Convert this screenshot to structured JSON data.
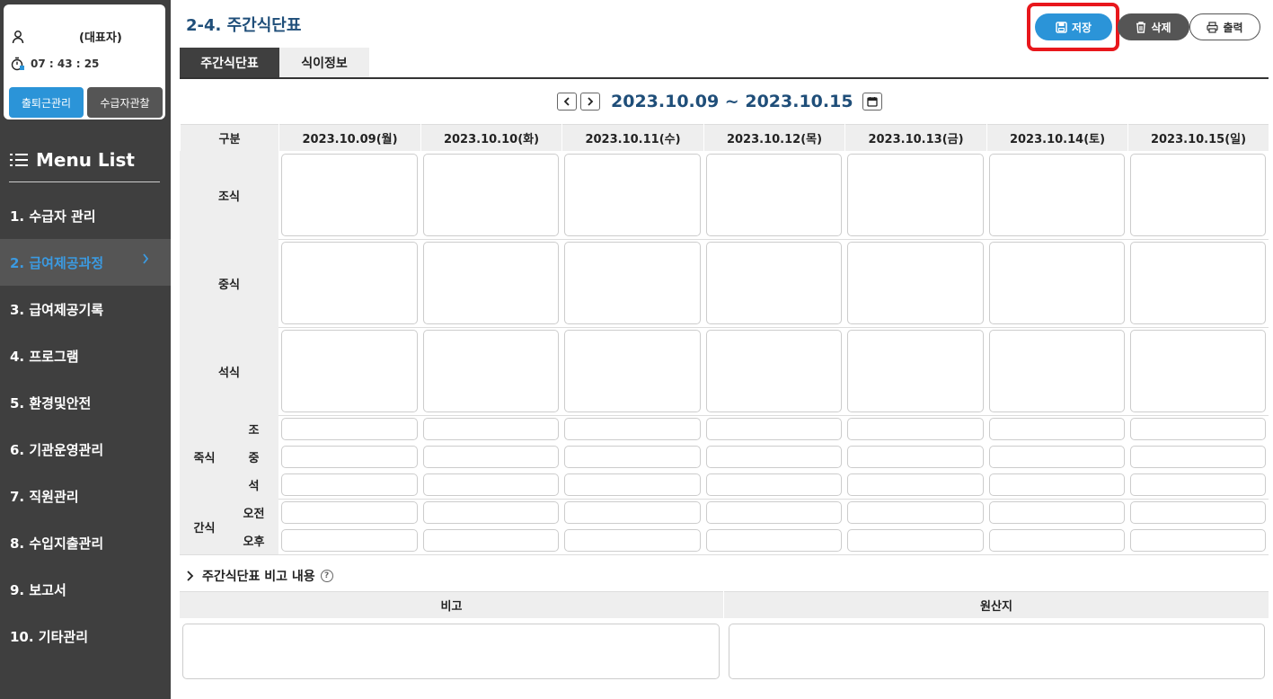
{
  "user": {
    "name": "(대표자)",
    "clock": "07 : 43 : 25",
    "attendance_btn": "출퇴근관리",
    "observe_btn": "수급자관찰"
  },
  "menu": {
    "title": "Menu List",
    "items": [
      {
        "label": "1. 수급자 관리"
      },
      {
        "label": "2. 급여제공과정"
      },
      {
        "label": "3. 급여제공기록"
      },
      {
        "label": "4. 프로그램"
      },
      {
        "label": "5. 환경및안전"
      },
      {
        "label": "6. 기관운영관리"
      },
      {
        "label": "7. 직원관리"
      },
      {
        "label": "8. 수입지출관리"
      },
      {
        "label": "9. 보고서"
      },
      {
        "label": "10. 기타관리"
      }
    ],
    "active_index": 1
  },
  "page": {
    "title": "2-4. 주간식단표"
  },
  "toolbar": {
    "save": "저장",
    "delete": "삭제",
    "print": "출력"
  },
  "tabs": [
    {
      "label": "주간식단표"
    },
    {
      "label": "식이정보"
    }
  ],
  "date_nav": {
    "range": "2023.10.09 ~ 2023.10.15"
  },
  "grid": {
    "corner": "구분",
    "days": [
      "2023.10.09(월)",
      "2023.10.10(화)",
      "2023.10.11(수)",
      "2023.10.12(목)",
      "2023.10.13(금)",
      "2023.10.14(토)",
      "2023.10.15(일)"
    ],
    "meals": [
      "조식",
      "중식",
      "석식"
    ],
    "porridge": {
      "label": "죽식",
      "subs": [
        "조",
        "중",
        "석"
      ]
    },
    "snack": {
      "label": "간식",
      "subs": [
        "오전",
        "오후"
      ]
    }
  },
  "remarks": {
    "title": "주간식단표 비고 내용",
    "help": "?",
    "note_header": "비고",
    "origin_header": "원산지"
  },
  "colors": {
    "accent": "#2b94d8",
    "sidebar": "#3f3f3f",
    "title": "#1f4e79",
    "highlight": "#e8171c"
  }
}
